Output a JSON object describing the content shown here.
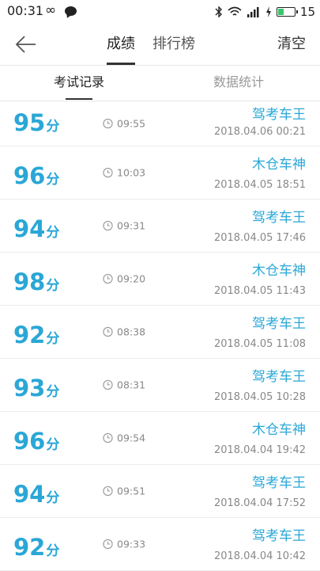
{
  "status_bar": {
    "time": "00:31",
    "infinity_symbol": "∞",
    "battery": "15"
  },
  "header": {
    "tabs": [
      {
        "label": "成绩",
        "active": true
      },
      {
        "label": "排行榜",
        "active": false
      }
    ],
    "clear_label": "清空"
  },
  "subtabs": [
    {
      "label": "考试记录",
      "active": true
    },
    {
      "label": "数据统计",
      "active": false
    }
  ],
  "score_unit": "分",
  "records": [
    {
      "score": "95",
      "duration": "09:55",
      "name": "驾考车王",
      "datetime": "2018.04.06  00:21"
    },
    {
      "score": "96",
      "duration": "10:03",
      "name": "木仓车神",
      "datetime": "2018.04.05  18:51"
    },
    {
      "score": "94",
      "duration": "09:31",
      "name": "驾考车王",
      "datetime": "2018.04.05  17:46"
    },
    {
      "score": "98",
      "duration": "09:20",
      "name": "木仓车神",
      "datetime": "2018.04.05  11:43"
    },
    {
      "score": "92",
      "duration": "08:38",
      "name": "驾考车王",
      "datetime": "2018.04.05  11:08"
    },
    {
      "score": "93",
      "duration": "08:31",
      "name": "驾考车王",
      "datetime": "2018.04.05  10:28"
    },
    {
      "score": "96",
      "duration": "09:54",
      "name": "木仓车神",
      "datetime": "2018.04.04  19:42"
    },
    {
      "score": "94",
      "duration": "09:51",
      "name": "驾考车王",
      "datetime": "2018.04.04  17:52"
    },
    {
      "score": "92",
      "duration": "09:33",
      "name": "驾考车王",
      "datetime": "2018.04.04  10:42"
    }
  ],
  "colors": {
    "accent": "#2aa7d6",
    "text": "#333333",
    "muted": "#888888"
  }
}
